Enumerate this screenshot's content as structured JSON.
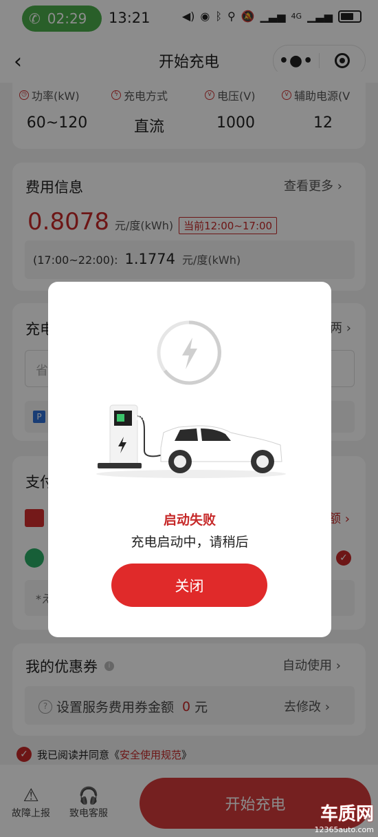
{
  "status_bar": {
    "call_timer": "02:29",
    "clock": "13:21",
    "network": "4G"
  },
  "nav": {
    "title": "开始充电"
  },
  "specs": [
    {
      "label": "功率(kW)",
      "value": "60~120"
    },
    {
      "label": "充电方式",
      "value": "直流"
    },
    {
      "label": "电压(V)",
      "value": "1000"
    },
    {
      "label": "辅助电源(V",
      "value": "12"
    }
  ],
  "fees": {
    "title": "费用信息",
    "more": "查看更多",
    "price": "0.8078",
    "unit": "元/度(kWh)",
    "current_tag": "当前12:00~17:00",
    "next_period": "(17:00~22:00):",
    "next_price": "1.1774",
    "next_unit": "元/度(kWh)"
  },
  "vehicle": {
    "title_partial": "充电",
    "more_partial": "两",
    "plate_placeholder_partial": "省",
    "p_badge": "P"
  },
  "payment": {
    "title_partial": "支付",
    "balance_partial": "额",
    "note_partial": "*え"
  },
  "coupon": {
    "title": "我的优惠券",
    "auto": "自动使用",
    "set_text": "设置服务费用券金额",
    "amount": "0",
    "amount_unit": "元",
    "modify": "去修改"
  },
  "agreement": {
    "prefix": "我已阅读并同意《",
    "link": "安全使用规范",
    "suffix": "》"
  },
  "bottom": {
    "report": "故障上报",
    "service": "致电客服",
    "start": "开始充电"
  },
  "modal": {
    "title": "启动失败",
    "message": "充电启动中，请稍后",
    "close": "关闭",
    "watermark_text": "w.12365auto.com"
  },
  "watermark": {
    "brand": "车质网",
    "url": "12365auto.com"
  },
  "colors": {
    "accent": "#c62828",
    "button": "#e02a2a",
    "call_green": "#4cae4c"
  }
}
